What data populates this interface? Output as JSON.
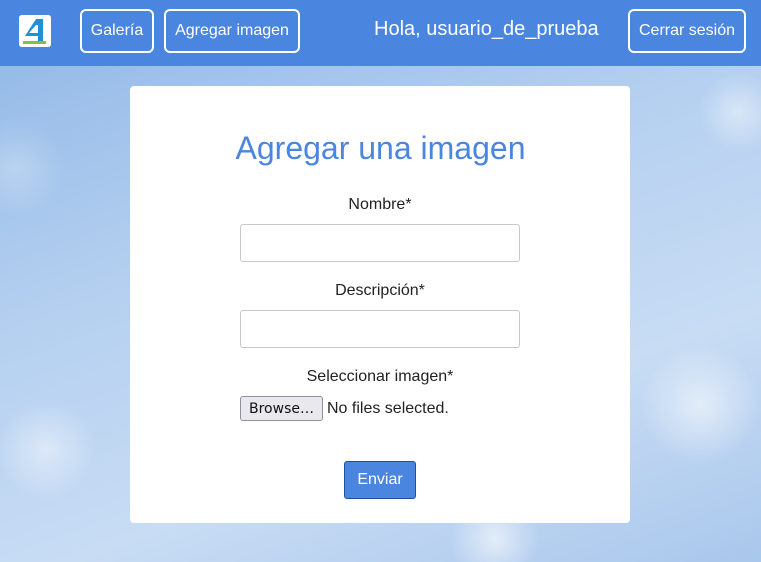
{
  "nav": {
    "logo_icon": "app-logo-icon",
    "gallery_label": "Galería",
    "add_image_label": "Agregar imagen",
    "greeting": "Hola, usuario_de_prueba",
    "logout_label": "Cerrar sesión"
  },
  "form": {
    "title": "Agregar una imagen",
    "name_label": "Nombre*",
    "name_value": "",
    "description_label": "Descripción*",
    "description_value": "",
    "image_label": "Seleccionar imagen*",
    "browse_label": "Browse…",
    "file_status": "No files selected.",
    "submit_label": "Enviar"
  },
  "colors": {
    "accent": "#4a86e0",
    "navbar": "#4a86e0",
    "card": "#ffffff"
  }
}
